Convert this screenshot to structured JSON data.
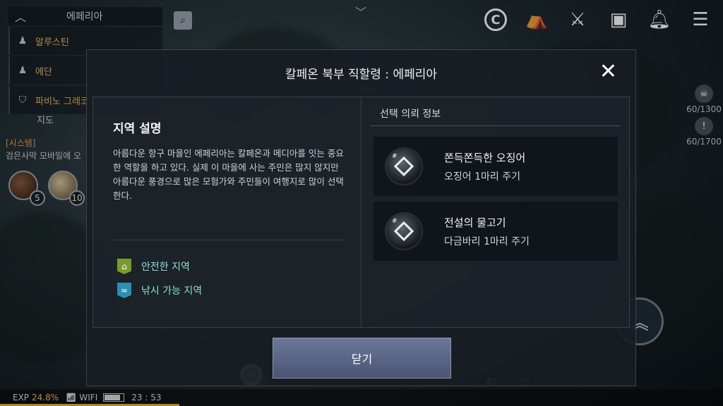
{
  "location_panel": {
    "current": "에페리아",
    "items": [
      {
        "label": "알루스틴",
        "icon": "person-icon"
      },
      {
        "label": "에단",
        "icon": "person-icon"
      },
      {
        "label": "파비노 그레코",
        "icon": "shield-icon"
      }
    ],
    "map_link": "지도"
  },
  "chat": {
    "channel": "[시스템]",
    "message": "검은사막 모바일에 오"
  },
  "pets": [
    {
      "count": "5"
    },
    {
      "count": "10"
    }
  ],
  "toolbar": {
    "icons": [
      "copyright-icon",
      "camp-icon",
      "crossed-weapons-icon",
      "bag-icon",
      "bell-icon",
      "menu-icon"
    ]
  },
  "side_stats": [
    {
      "value": "60/1300",
      "icon": "skull-icon"
    },
    {
      "value": "60/1700",
      "icon": "exclamation-icon"
    }
  ],
  "skills": {
    "left": "42",
    "right": "75"
  },
  "status_bar": {
    "exp_label": "EXP",
    "exp_value": "24.8%",
    "exp_fraction": 0.248,
    "wifi_label": "WIFI",
    "battery_fraction": 0.85,
    "time": "23 : 53"
  },
  "modal": {
    "title": "칼페온 북부 직할령 : 에페리아",
    "region": {
      "heading": "지역 설명",
      "description": "아름다운 항구 마을인 에페리아는 칼페온과 메디아를 잇는 중요한 역할을 하고 있다. 실제 이 마을에 사는 주민은 많지 않지만 아름다운 풍경으로 많은 모험가와 주민들이 여행지로 많이 선택한다.",
      "tags": [
        {
          "label": "안전한 지역",
          "icon": "house-icon",
          "color": "#7a9a30"
        },
        {
          "label": "낚시 가능 지역",
          "icon": "fish-icon",
          "color": "#2d8fb0"
        }
      ]
    },
    "quests": {
      "heading": "선택 의뢰 정보",
      "items": [
        {
          "name": "쫀득쫀득한 오징어",
          "detail": "오징어 1마리 주기"
        },
        {
          "name": "전설의 물고기",
          "detail": "다금바리 1마리 주기"
        }
      ]
    },
    "close_button": "닫기"
  }
}
